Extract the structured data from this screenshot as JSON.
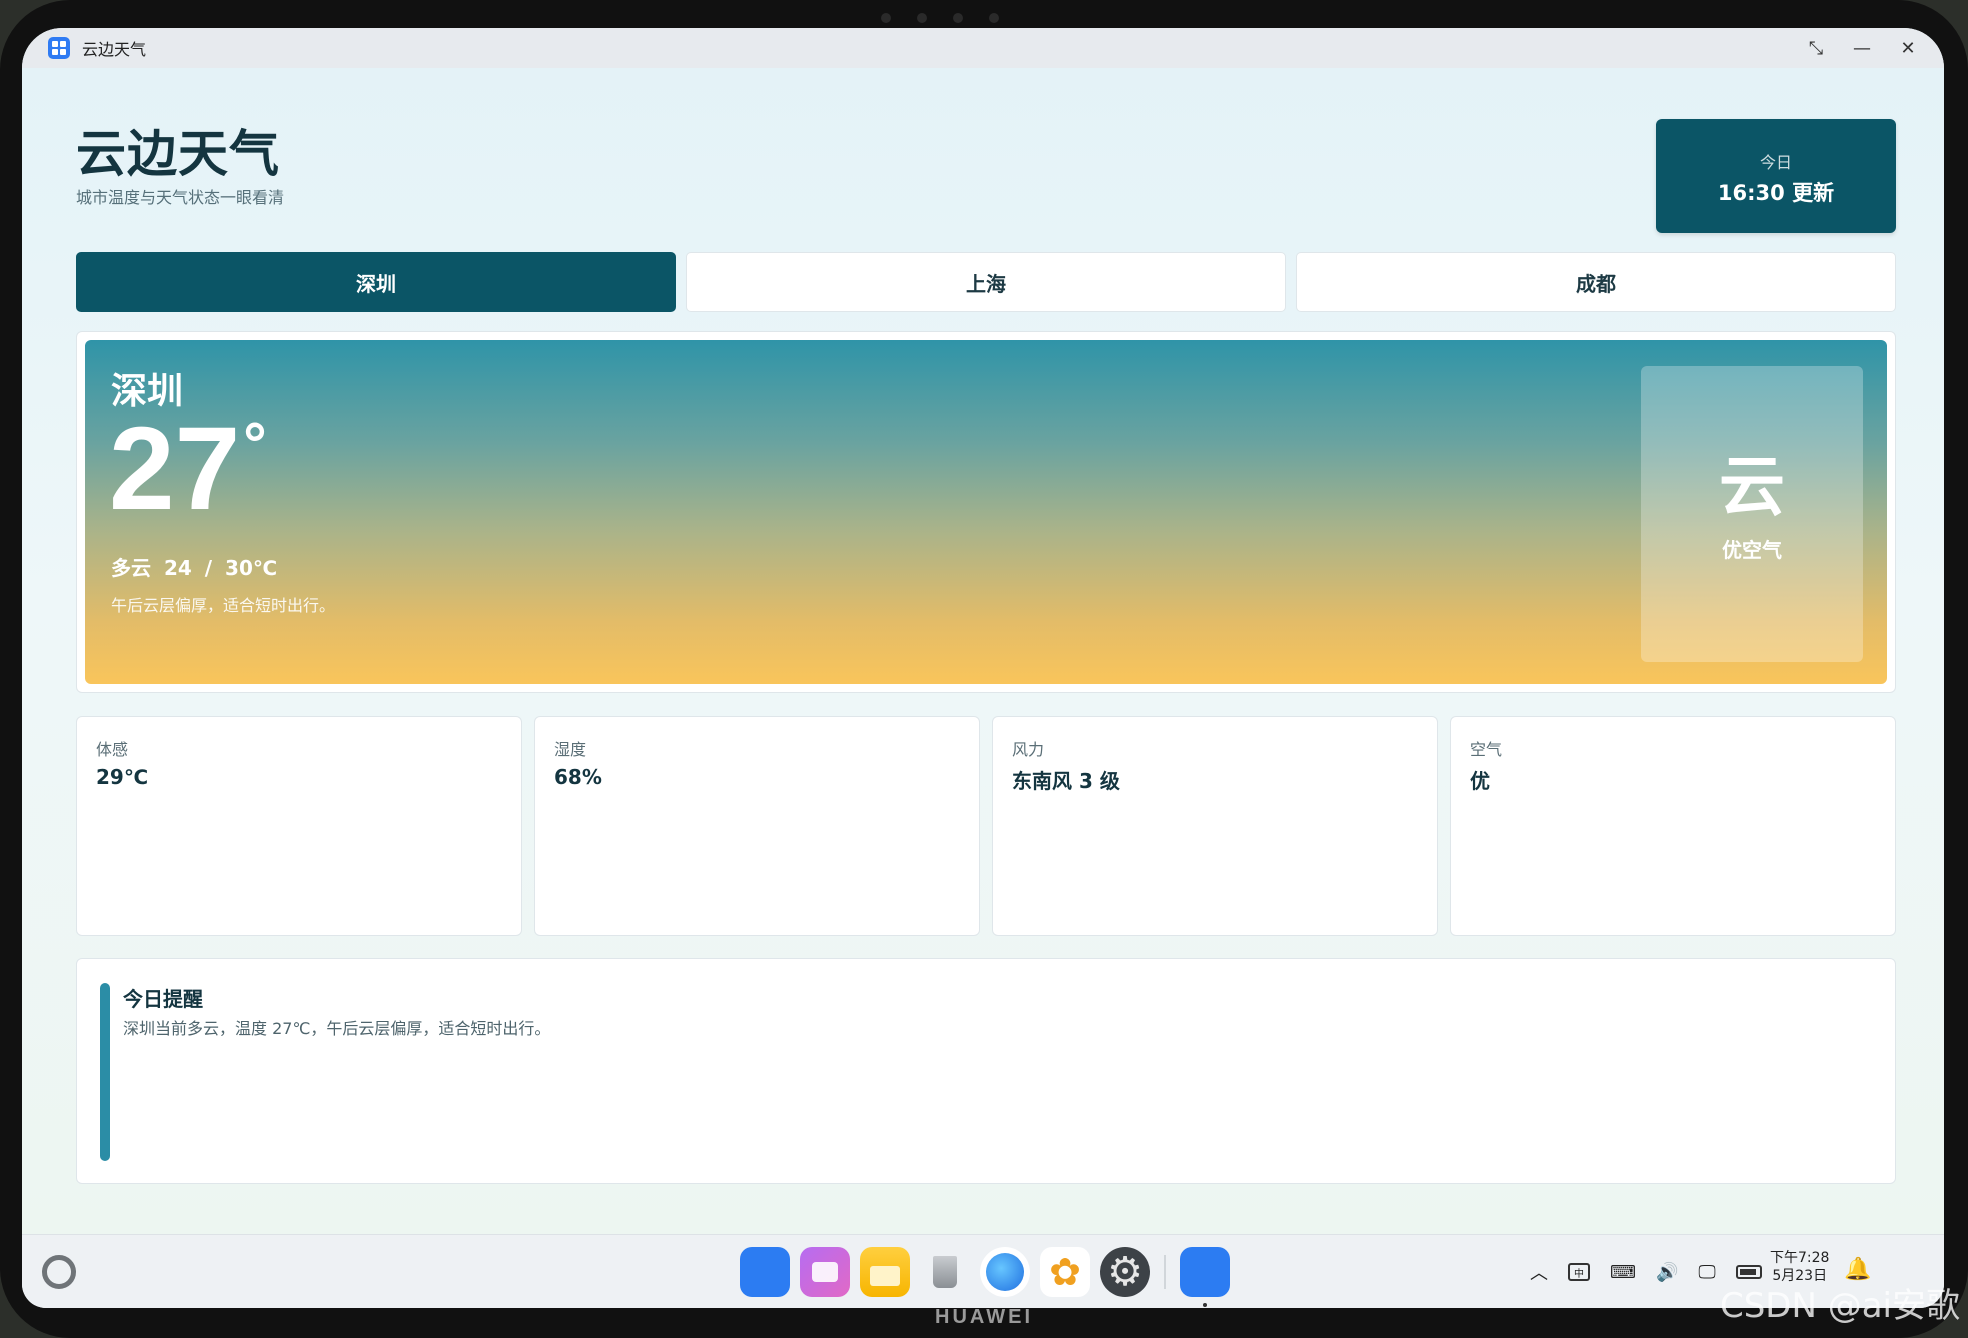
{
  "window": {
    "title": "云边天气",
    "controls": [
      "restore-icon",
      "minimize-icon",
      "close-icon"
    ]
  },
  "header": {
    "title": "云边天气",
    "subtitle": "城市温度与天气状态一眼看清",
    "update_label": "今日",
    "update_value": "16:30 更新"
  },
  "tabs": [
    {
      "label": "深圳",
      "active": true
    },
    {
      "label": "上海",
      "active": false
    },
    {
      "label": "成都",
      "active": false
    }
  ],
  "hero": {
    "city": "深圳",
    "temperature": "27",
    "degree_symbol": "°",
    "condition": "多云  24 / 30℃",
    "description": "午后云层偏厚，适合短时出行。",
    "icon_glyph": "云",
    "air_quality_label": "优空气"
  },
  "stats": [
    {
      "label": "体感",
      "value": "29℃"
    },
    {
      "label": "湿度",
      "value": "68%"
    },
    {
      "label": "风力",
      "value": "东南风 3 级"
    },
    {
      "label": "空气",
      "value": "优"
    }
  ],
  "reminder": {
    "title": "今日提醒",
    "body": "深圳当前多云，温度 27℃，午后云层偏厚，适合短时出行。"
  },
  "taskbar": {
    "dock_icons": [
      "app-center-icon",
      "multitask-icon",
      "files-icon",
      "trash-icon",
      "browser-icon",
      "photos-icon",
      "settings-icon",
      "weather-app-icon"
    ],
    "tray_ime": "中",
    "clock_time": "下午7:28",
    "clock_date": "5月23日"
  },
  "device": {
    "brand": "HUAWEI",
    "watermark": "CSDN @ai安歌"
  },
  "colors": {
    "primary": "#0b5566",
    "accent_bar": "#2b8da6",
    "hero_top": "#2f94a8",
    "hero_bottom": "#f9c55b"
  }
}
